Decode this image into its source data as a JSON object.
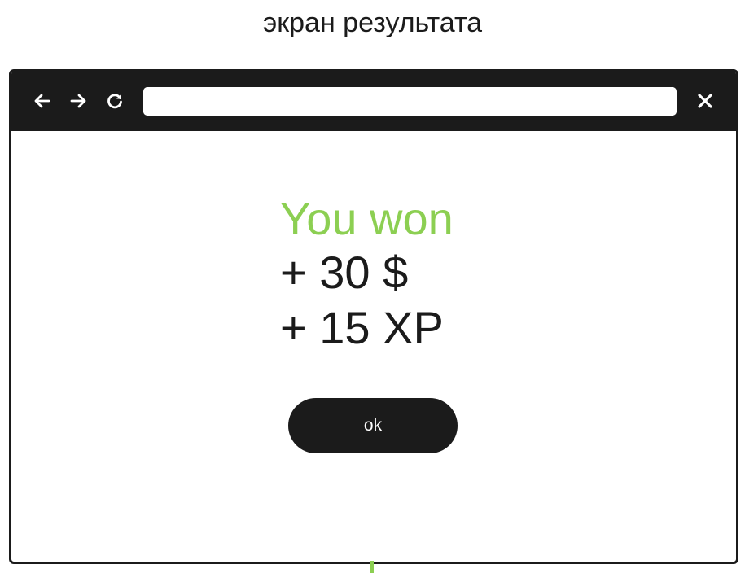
{
  "caption": "экран результата",
  "browser": {
    "back_icon": "arrow-left-icon",
    "forward_icon": "arrow-right-icon",
    "reload_icon": "reload-icon",
    "close_icon": "close-icon",
    "address_value": ""
  },
  "result": {
    "title": "You won",
    "rewards": [
      "+ 30 $",
      "+ 15 XP"
    ],
    "ok_label": "ok"
  },
  "colors": {
    "accent_green": "#8ccf52",
    "dark": "#1b1b1b",
    "background": "#ffffff"
  }
}
